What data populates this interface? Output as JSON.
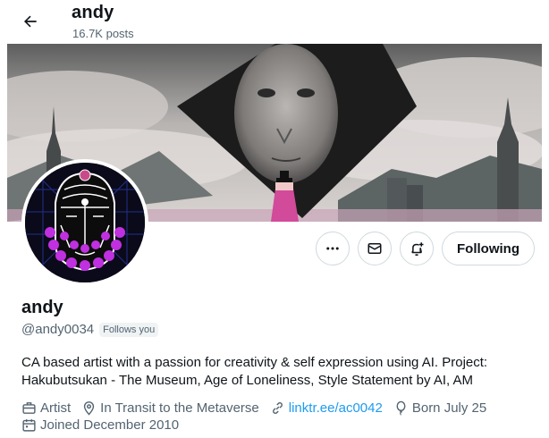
{
  "header": {
    "title": "andy",
    "posts_count": "16.7K posts"
  },
  "profile": {
    "display_name": "andy",
    "handle": "@andy0034",
    "follows_you": "Follows you",
    "bio": "CA based artist with a passion for creativity & self expression using AI. Project: Hakubutsukan - The Museum, Age of Loneliness, Style Statement by AI, AM",
    "category": "Artist",
    "location": "In Transit to the Metaverse",
    "website": "linktr.ee/ac0042",
    "birthday": "Born July 25",
    "joined": "Joined December 2010"
  },
  "actions": {
    "following_label": "Following"
  },
  "icons": {
    "back": "arrow-left-icon",
    "more": "more-icon",
    "message": "envelope-icon",
    "notify": "bell-plus-icon",
    "category": "briefcase-icon",
    "location": "map-pin-icon",
    "link": "link-icon",
    "birthday": "balloon-icon",
    "joined": "calendar-icon"
  },
  "colors": {
    "text": "#0f1419",
    "muted": "#536471",
    "link": "#1d9bf0",
    "border": "#cfd9de",
    "badge_bg": "#eff3f4",
    "avatar_accent": "#c030e0"
  }
}
